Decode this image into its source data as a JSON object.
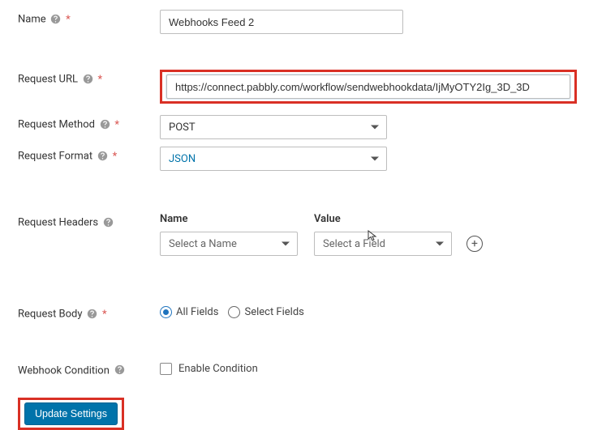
{
  "fields": {
    "name": {
      "label": "Name",
      "value": "Webhooks Feed 2"
    },
    "url": {
      "label": "Request URL",
      "value": "https://connect.pabbly.com/workflow/sendwebhookdata/IjMyOTY2Ig_3D_3D"
    },
    "method": {
      "label": "Request Method",
      "value": "POST"
    },
    "format": {
      "label": "Request Format",
      "value": "JSON"
    }
  },
  "headers": {
    "label": "Request Headers",
    "name_col": "Name",
    "value_col": "Value",
    "name_placeholder": "Select a Name",
    "value_placeholder": "Select a Field"
  },
  "body": {
    "label": "Request Body",
    "all": "All Fields",
    "select": "Select Fields"
  },
  "condition": {
    "label": "Webhook Condition",
    "enable": "Enable Condition"
  },
  "buttons": {
    "update": "Update Settings"
  }
}
